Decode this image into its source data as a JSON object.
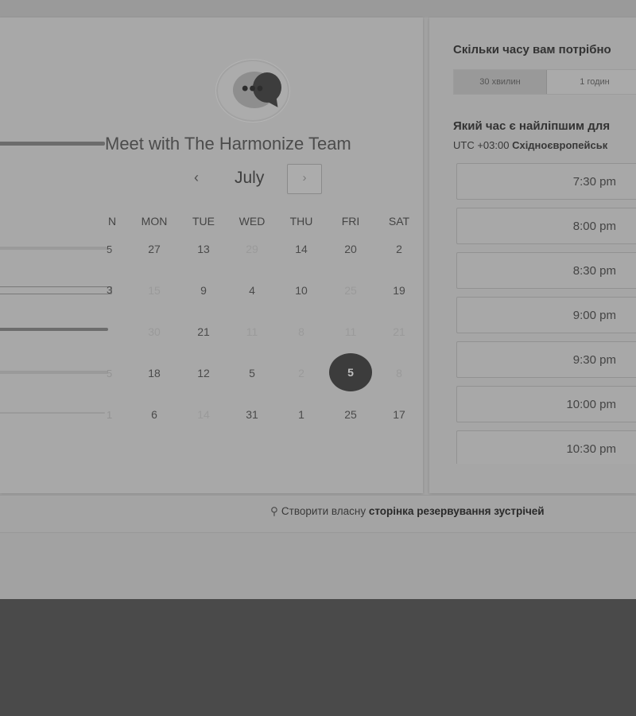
{
  "calendar": {
    "title": "Meet with The Harmonize Team",
    "month": "July",
    "prev_arrow": "‹",
    "next_arrow": "›",
    "weekdays": [
      "N",
      "MON",
      "TUE",
      "WED",
      "THU",
      "FRI",
      "SAT"
    ],
    "ghost_column": [
      "5",
      "3",
      "5",
      "1"
    ],
    "rows": [
      [
        "27",
        "13",
        "29",
        "14",
        "20",
        "2"
      ],
      [
        "15",
        "9",
        "4",
        "10",
        "25",
        "19"
      ],
      [
        "30",
        "21",
        "11",
        "8",
        "11",
        "21"
      ],
      [
        "18",
        "12",
        "5",
        "2",
        "5",
        "8"
      ],
      [
        "6",
        "14",
        "31",
        "1",
        "25",
        "17"
      ]
    ],
    "selected_day": "5"
  },
  "booking": {
    "duration_question": "Скільки часу вам потрібно",
    "durations": [
      "30 хвилин",
      "1 годин"
    ],
    "time_question": "Який час є найліпшим для",
    "timezone_code": "UTC +03:00",
    "timezone_name": "Східноєвропейськ",
    "slots": [
      "7:30 pm",
      "8:00 pm",
      "8:30 pm",
      "9:00 pm",
      "9:30 pm",
      "10:00 pm",
      "10:30 pm"
    ]
  },
  "footer": {
    "icon": "hubspot-sprocket-icon",
    "text": "Створити власну",
    "bold_text": "сторінка резервування зустрічей"
  },
  "colors": {
    "selected_day_bg": "#3c3c3c",
    "page_bg": "#a2a2a2",
    "dark_bottom": "#4a4a4a"
  }
}
